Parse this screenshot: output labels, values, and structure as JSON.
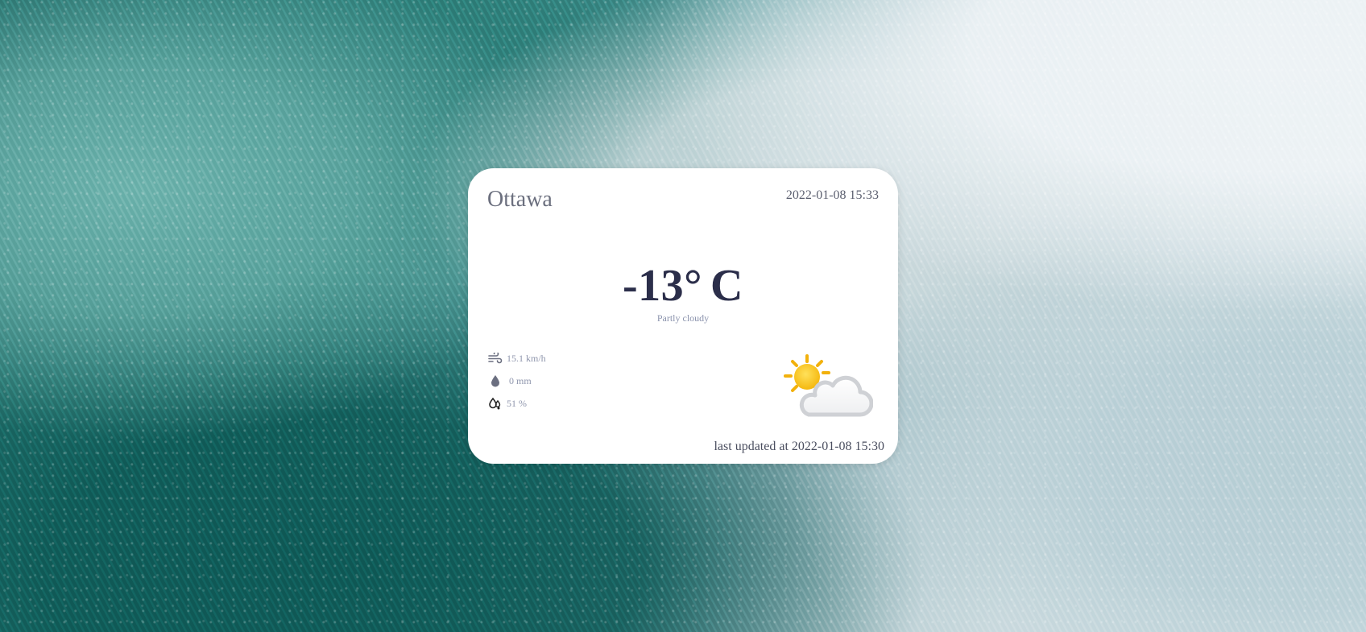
{
  "weather": {
    "city": "Ottawa",
    "datetime": "2022-01-08 15:33",
    "temperature": "-13°",
    "temperature_unit": "C",
    "condition": "Partly cloudy",
    "details": [
      {
        "icon": "wind-icon",
        "value": "15.1 km/h"
      },
      {
        "icon": "raindrop-icon",
        "value": "0 mm"
      },
      {
        "icon": "humidity-icon",
        "value": "51 %"
      }
    ],
    "condition_icon": "partly-cloudy-icon",
    "updated_label": "last updated at 2022-01-08 15:30"
  },
  "colors": {
    "card_background": "#ffffff",
    "temperature": "#2b2e4a",
    "secondary_text": "#8f96ad",
    "sun": "#f7c21a",
    "cloud": "#d9dadd"
  }
}
